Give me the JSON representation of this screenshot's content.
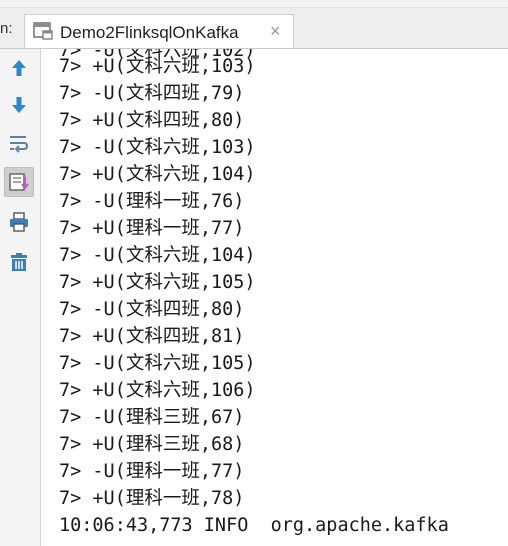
{
  "tab": {
    "prefix": "n:",
    "title": "Demo2FlinksqlOnKafka",
    "close": "×"
  },
  "sidebar": {
    "items": [
      {
        "name": "up-arrow-icon",
        "label": "up"
      },
      {
        "name": "down-arrow-icon",
        "label": "down"
      },
      {
        "name": "soft-wrap-icon",
        "label": "wrap"
      },
      {
        "name": "scroll-to-end-icon",
        "label": "scroll"
      },
      {
        "name": "print-icon",
        "label": "print"
      },
      {
        "name": "trash-icon",
        "label": "clear"
      }
    ]
  },
  "console": {
    "lines": [
      "7> +U(文科六班,103)",
      "7> -U(文科四班,79)",
      "7> +U(文科四班,80)",
      "7> -U(文科六班,103)",
      "7> +U(文科六班,104)",
      "7> -U(理科一班,76)",
      "7> +U(理科一班,77)",
      "7> -U(文科六班,104)",
      "7> +U(文科六班,105)",
      "7> -U(文科四班,80)",
      "7> +U(文科四班,81)",
      "7> -U(文科六班,105)",
      "7> +U(文科六班,106)",
      "7> -U(理科三班,67)",
      "7> +U(理科三班,68)",
      "7> -U(理科一班,77)",
      "7> +U(理科一班,78)",
      "10:06:43,773 INFO  org.apache.kafka"
    ]
  },
  "colors": {
    "arrow_blue": "#2f86c9",
    "toolbar_gray": "#6b6b6b",
    "print_blue": "#3a7fc0"
  }
}
